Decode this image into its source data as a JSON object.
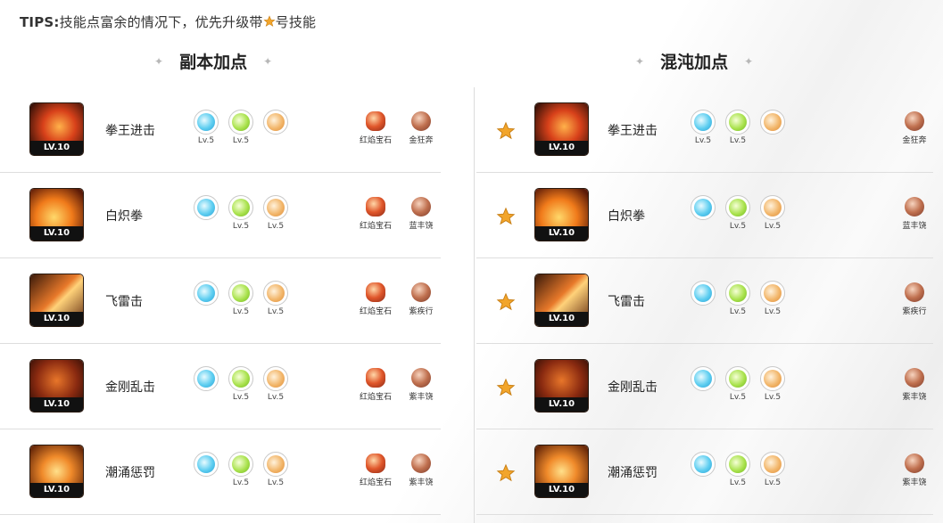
{
  "tips": {
    "prefix": "TIPS:",
    "text": "技能点富余的情况下，优先升级带",
    "suffix": "号技能"
  },
  "sections": {
    "left_title": "副本加点",
    "right_title": "混沌加点"
  },
  "left_rows": [
    {
      "name": "拳王进击",
      "level": "LV.10",
      "r1": "Lv.5",
      "r2": "Lv.5",
      "r3": "",
      "gem1": "红焰宝石",
      "gem2": "金狂奔"
    },
    {
      "name": "白炽拳",
      "level": "LV.10",
      "r1": "",
      "r2": "Lv.5",
      "r3": "Lv.5",
      "gem1": "红焰宝石",
      "gem2": "蓝丰饶"
    },
    {
      "name": "飞雷击",
      "level": "LV.10",
      "r1": "",
      "r2": "Lv.5",
      "r3": "Lv.5",
      "gem1": "红焰宝石",
      "gem2": "紫疾行"
    },
    {
      "name": "金刚乱击",
      "level": "LV.10",
      "r1": "",
      "r2": "Lv.5",
      "r3": "Lv.5",
      "gem1": "红焰宝石",
      "gem2": "紫丰饶"
    },
    {
      "name": "潮涌惩罚",
      "level": "LV.10",
      "r1": "",
      "r2": "Lv.5",
      "r3": "Lv.5",
      "gem1": "红焰宝石",
      "gem2": "紫丰饶"
    }
  ],
  "right_rows": [
    {
      "name": "拳王进击",
      "level": "LV.10",
      "r1": "Lv.5",
      "r2": "Lv.5",
      "r3": "",
      "gem2": "金狂奔"
    },
    {
      "name": "白炽拳",
      "level": "LV.10",
      "r1": "",
      "r2": "Lv.5",
      "r3": "Lv.5",
      "gem2": "蓝丰饶"
    },
    {
      "name": "飞雷击",
      "level": "LV.10",
      "r1": "",
      "r2": "Lv.5",
      "r3": "Lv.5",
      "gem2": "紫疾行"
    },
    {
      "name": "金刚乱击",
      "level": "LV.10",
      "r1": "",
      "r2": "Lv.5",
      "r3": "Lv.5",
      "gem2": "紫丰饶"
    },
    {
      "name": "潮涌惩罚",
      "level": "LV.10",
      "r1": "",
      "r2": "Lv.5",
      "r3": "Lv.5",
      "gem2": "紫丰饶"
    }
  ],
  "icons": {
    "priority_star": "star-icon",
    "sparkle": "sparkle-icon"
  },
  "colors": {
    "star": "#f2a52b",
    "divider": "#dedede"
  }
}
